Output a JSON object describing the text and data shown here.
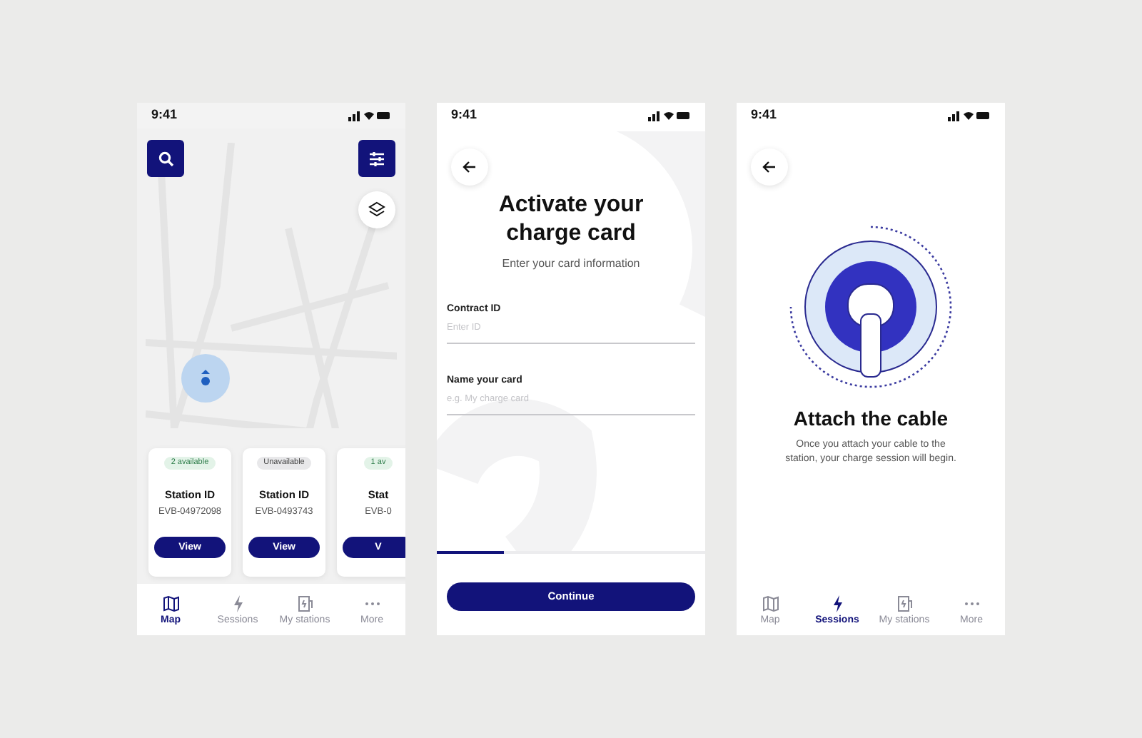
{
  "screens": [
    {
      "kind": "map",
      "status_time": "9:41",
      "cards": [
        {
          "badge": "2 available",
          "available": true,
          "title": "Station ID",
          "station": "EVB-04972098",
          "button": "View"
        },
        {
          "badge": "Unavailable",
          "available": false,
          "title": "Station ID",
          "station": "EVB-0493743",
          "button": "View"
        },
        {
          "badge": "1 av",
          "available": true,
          "title": "Stat",
          "station": "EVB-0",
          "button": "V"
        }
      ],
      "nav": [
        {
          "label": "Map",
          "selected": true
        },
        {
          "label": "Sessions",
          "selected": false
        },
        {
          "label": "My stations",
          "selected": false
        },
        {
          "label": "More",
          "selected": false
        }
      ]
    },
    {
      "kind": "form",
      "status_time": "9:41",
      "title": "Activate your charge card",
      "subtitle": "Enter your card information",
      "fields": [
        {
          "label": "Contract ID",
          "placeholder": "Enter ID"
        },
        {
          "label": "Name your card",
          "placeholder": "e.g. My charge card"
        }
      ],
      "progress": {
        "level": 0.25
      },
      "button": "Continue"
    },
    {
      "kind": "cable",
      "status_time": "9:41",
      "title": "Attach the cable",
      "body": "Once you attach your cable to the station, your charge session will begin.",
      "nav": [
        {
          "label": "Map",
          "selected": false
        },
        {
          "label": "Sessions",
          "selected": true
        },
        {
          "label": "My stations",
          "selected": false
        },
        {
          "label": "More",
          "selected": false
        }
      ]
    }
  ]
}
